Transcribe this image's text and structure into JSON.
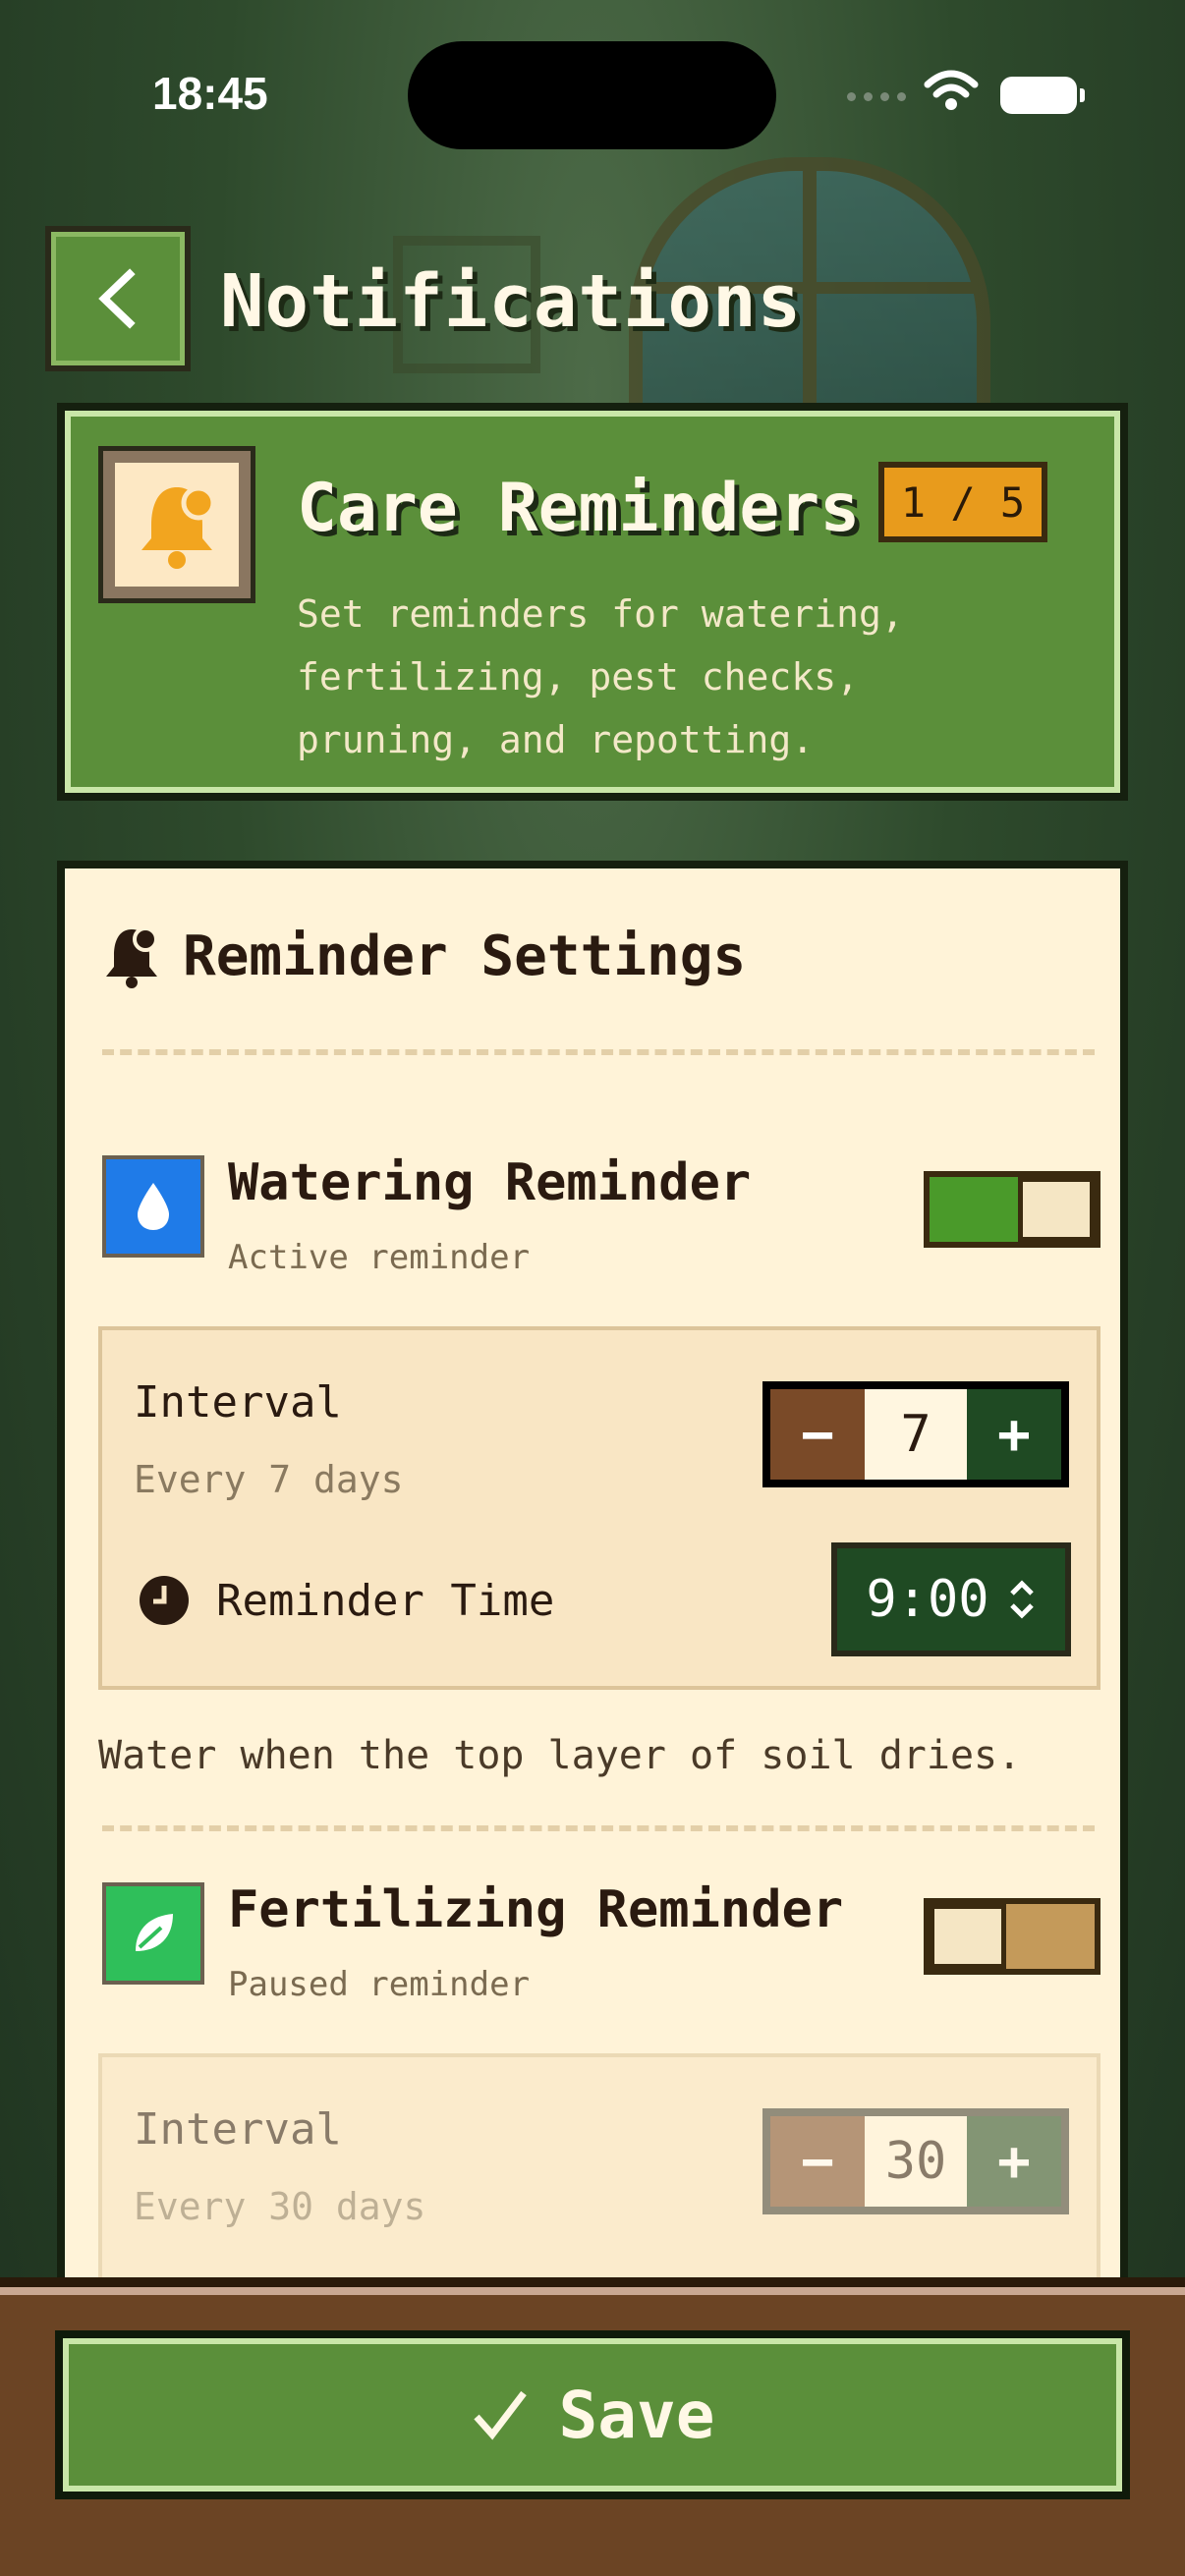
{
  "status_bar": {
    "time": "18:45"
  },
  "header": {
    "title": "Notifications",
    "back_icon": "chevron-left-icon"
  },
  "care_card": {
    "title": "Care Reminders",
    "badge": "1 / 5",
    "description": "Set reminders for watering, fertilizing, pest checks, pruning, and repotting.",
    "icon": "bell-icon"
  },
  "settings": {
    "title": "Reminder Settings",
    "reminders": [
      {
        "title": "Watering Reminder",
        "status": "Active reminder",
        "enabled": true,
        "icon": "water-drop-icon",
        "icon_color": "#1f7be8",
        "interval_label": "Interval",
        "interval_text": "Every 7 days",
        "interval_value": "7",
        "time_label": "Reminder Time",
        "time_value": "9:00",
        "note": "Water when the top layer of soil dries."
      },
      {
        "title": "Fertilizing Reminder",
        "status": "Paused reminder",
        "enabled": false,
        "icon": "leaf-icon",
        "icon_color": "#2fbf5a",
        "interval_label": "Interval",
        "interval_text": "Every 30 days",
        "interval_value": "30"
      }
    ]
  },
  "footer": {
    "save_label": "Save",
    "save_icon": "checkmark-icon"
  },
  "colors": {
    "accent_green": "#5b8f3a",
    "cream": "#fff3d8",
    "orange": "#e89b1c",
    "brown": "#6b4424"
  }
}
